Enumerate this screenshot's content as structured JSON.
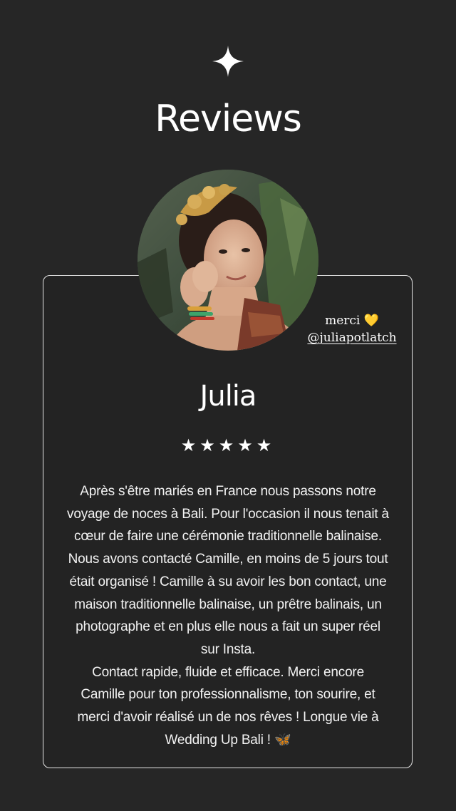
{
  "header": {
    "icon": "sparkle-icon",
    "title": "Reviews"
  },
  "photo_tag": {
    "text": "merci",
    "emoji": "💛",
    "mention": "@juliapotlatch"
  },
  "review": {
    "name": "Julia",
    "rating": 5,
    "stars": "★★★★★",
    "lines": [
      "Après s'être mariés en France nous passons notre",
      "voyage de noces à Bali. Pour l'occasion il nous tenait à",
      "cœur de faire une cérémonie traditionnelle balinaise.",
      "Nous avons contacté Camille, en moins de 5 jours tout",
      "était organisé ! Camille à su avoir les bon contact, une",
      "maison traditionnelle balinaise, un prêtre balinais, un",
      "photographe et en plus elle nous a fait un super réel",
      "sur Insta.",
      "Contact rapide, fluide et efficace. Merci encore",
      "Camille pour ton professionnalisme, ton sourire, et",
      "merci d'avoir réalisé un de nos rêves ! Longue vie à",
      "Wedding Up Bali !"
    ],
    "end_emoji": "🦋"
  },
  "colors": {
    "background": "#262626",
    "card_border": "#e6e6e6",
    "text": "#ffffff"
  }
}
